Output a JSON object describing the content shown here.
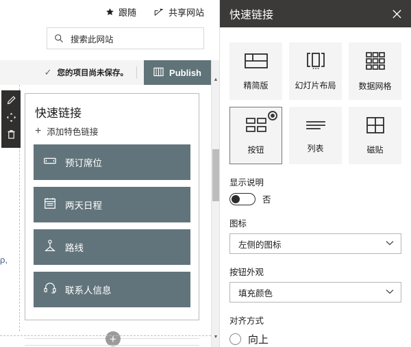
{
  "canvas": {
    "commands": [
      {
        "icon": "star-icon",
        "label": "跟随"
      },
      {
        "icon": "share-icon",
        "label": "共享网站"
      }
    ],
    "search": {
      "placeholder": "搜索此网站",
      "value": "搜索此网站",
      "icon": "search-icon"
    },
    "savebar": {
      "status_icon": "checkmark-icon",
      "status_text": "您的项目尚未保存。",
      "publish_label": "Publish",
      "publish_icon": "publish-book-icon",
      "publish_color": "#5f7378"
    },
    "webpart_toolbar": [
      {
        "icon": "pencil-icon",
        "name": "edit-web-part"
      },
      {
        "icon": "move-icon",
        "name": "move-web-part"
      },
      {
        "icon": "trash-icon",
        "name": "delete-web-part"
      }
    ],
    "webpart": {
      "title": "快速链接",
      "add_link_label": "添加特色链接",
      "add_link_icon": "plus-icon",
      "button_color": "#62747b",
      "links": [
        {
          "icon": "ticket-icon",
          "label": "预订席位"
        },
        {
          "icon": "calendar-icon",
          "label": "两天日程"
        },
        {
          "icon": "route-icon",
          "label": "路线"
        },
        {
          "icon": "headset-icon",
          "label": "联系人信息"
        }
      ]
    },
    "add_section_icon": "plus-circle-icon",
    "gutter_glyph": "ρ,",
    "scrollbar": {
      "up_icon": "caret-up-icon",
      "down_icon": "caret-down-icon"
    }
  },
  "pane": {
    "title": "快速链接",
    "close_icon": "close-icon",
    "header_color": "#3b3a39",
    "layouts": [
      {
        "id": "compact",
        "label": "精简版",
        "icon": "compact-layout-icon",
        "selected": false
      },
      {
        "id": "filmstrip",
        "label": "幻灯片布局",
        "icon": "filmstrip-layout-icon",
        "selected": false
      },
      {
        "id": "grid",
        "label": "数据网格",
        "icon": "grid-layout-icon",
        "selected": false
      },
      {
        "id": "button",
        "label": "按钮",
        "icon": "button-layout-icon",
        "selected": true
      },
      {
        "id": "list",
        "label": "列表",
        "icon": "list-layout-icon",
        "selected": false
      },
      {
        "id": "tile",
        "label": "磁贴",
        "icon": "tile-layout-icon",
        "selected": false
      }
    ],
    "show_description": {
      "label": "显示说明",
      "value": "否",
      "on": false
    },
    "icon_field": {
      "label": "图标",
      "value": "左侧的图标",
      "chevron": "chevron-down-icon"
    },
    "button_look": {
      "label": "按钮外观",
      "value": "填充颜色",
      "chevron": "chevron-down-icon"
    },
    "alignment": {
      "label": "对齐方式",
      "option_label": "向上",
      "selected": false
    }
  }
}
